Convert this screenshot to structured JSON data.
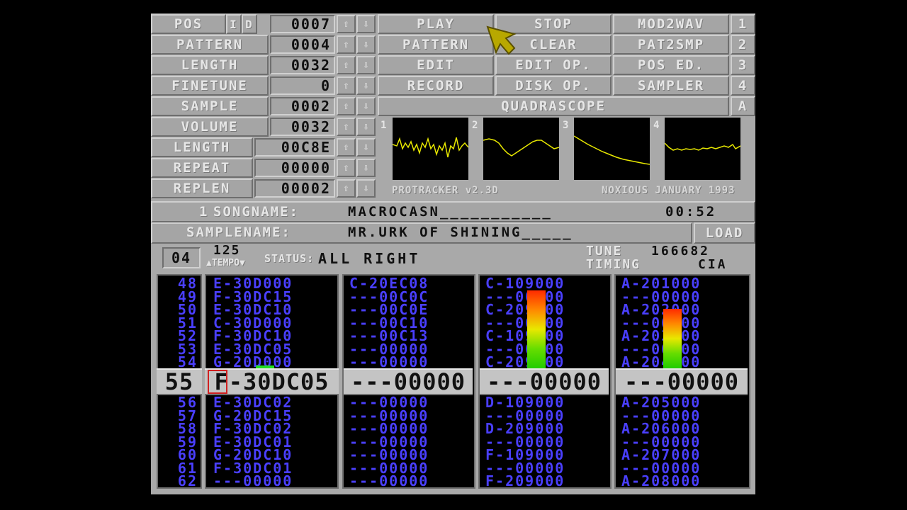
{
  "controls": {
    "pos": {
      "label": "POS",
      "value": "0007"
    },
    "pattern": {
      "label": "PATTERN",
      "value": "0004"
    },
    "length": {
      "label": "LENGTH",
      "value": "0032"
    },
    "finetune": {
      "label": "FINETUNE",
      "value": "0"
    },
    "sample": {
      "label": "SAMPLE",
      "value": "0002"
    },
    "volume": {
      "label": "VOLUME",
      "value": "0032"
    },
    "slength": {
      "label": "LENGTH",
      "value": "00C8E"
    },
    "repeat": {
      "label": "REPEAT",
      "value": "00000"
    },
    "replen": {
      "label": "REPLEN",
      "value": "00002"
    },
    "i_label": "I",
    "d_label": "D",
    "up": "⇧",
    "down": "⇩"
  },
  "buttons": {
    "play": "PLAY",
    "stop": "STOP",
    "mod2wav": "MOD2WAV",
    "pattern": "PATTERN",
    "clear": "CLEAR",
    "pat2smp": "PAT2SMP",
    "edit": "EDIT",
    "edit_op": "EDIT OP.",
    "pos_ed": "POS ED.",
    "record": "RECORD",
    "disk_op": "DISK OP.",
    "sampler": "SAMPLER",
    "quadrascope": "QUADRASCOPE",
    "n1": "1",
    "n2": "2",
    "n3": "3",
    "n4": "4",
    "a": "A",
    "load": "LOAD"
  },
  "scope": {
    "ch1": "1",
    "ch2": "2",
    "ch3": "3",
    "ch4": "4",
    "version": "PROTRACKER v2.3D",
    "credit": "NOXIOUS JANUARY 1993"
  },
  "song": {
    "index": "1",
    "label": "SONGNAME:",
    "name": "MACROCASN___________",
    "time": "00:52"
  },
  "sample_name": {
    "label": "SAMPLENAME:",
    "name": "MR.URK OF SHINING_____"
  },
  "status": {
    "octave": "04",
    "tempo": "125",
    "tempo_label": "▲TEMPO▼",
    "status_label": "STATUS:",
    "status_value": "ALL RIGHT",
    "tune_label": "TUNE",
    "tune_value": "166682",
    "timing_label": "TIMING",
    "timing_value": "CIA"
  },
  "pattern_rows": {
    "numbers_top": [
      "48",
      "49",
      "50",
      "51",
      "52",
      "53",
      "54"
    ],
    "ch1_top": [
      "E-30D000",
      "F-30DC15",
      "E-30DC10",
      "C-30D000",
      "F-30DC10",
      "E-30DC05",
      "G-20D000"
    ],
    "ch2_top": [
      "C-20EC08",
      "---00C0C",
      "---00C0E",
      "---00C10",
      "---00C13",
      "---00000",
      "---00000"
    ],
    "ch3_top": [
      "C-109000",
      "---00000",
      "C-209000",
      "---00000",
      "C-109000",
      "---00000",
      "C-209000"
    ],
    "ch4_top": [
      "A-201000",
      "---00000",
      "A-202000",
      "---00000",
      "A-203000",
      "---00000",
      "A-204000"
    ],
    "current_number": "55",
    "current_ch1": "F-30DC05",
    "current_ch2": "---00000",
    "current_ch3": "---00000",
    "current_ch4": "---00000",
    "numbers_bottom": [
      "56",
      "57",
      "58",
      "59",
      "60",
      "61",
      "62"
    ],
    "ch1_bottom": [
      "E-30DC02",
      "G-20DC15",
      "F-30DC02",
      "E-30DC01",
      "G-20DC10",
      "F-30DC01",
      "---00000"
    ],
    "ch2_bottom": [
      "---00000",
      "---00000",
      "---00000",
      "---00000",
      "---00000",
      "---00000",
      "---00000"
    ],
    "ch3_bottom": [
      "D-109000",
      "---00000",
      "D-209000",
      "---00000",
      "F-109000",
      "---00000",
      "F-209000"
    ],
    "ch4_bottom": [
      "A-205000",
      "---00000",
      "A-206000",
      "---00000",
      "A-207000",
      "---00000",
      "A-208000"
    ]
  },
  "vu_levels": {
    "ch1": 0.04,
    "ch3": 0.98,
    "ch4": 0.75
  },
  "colors": {
    "panel": "#a5a5a5",
    "note_text": "#4a3fff",
    "scope_line": "#e8e800",
    "pointer": "#b8a800"
  }
}
